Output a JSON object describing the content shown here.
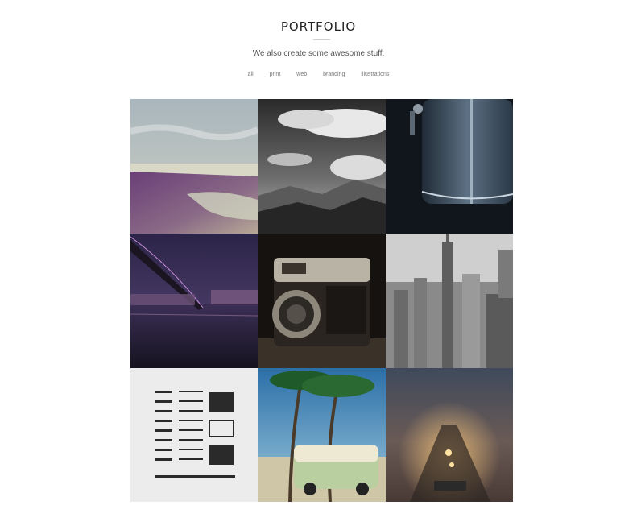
{
  "header": {
    "title": "PORTFOLIO",
    "subtitle": "We also create some awesome stuff."
  },
  "filters": [
    "all",
    "print",
    "web",
    "branding",
    "illustrations"
  ],
  "portfolio": {
    "items": [
      "beach-photo",
      "mountains-clouds-photo",
      "metal-tank-photo",
      "bridge-night-photo",
      "vintage-camera-photo",
      "city-skyline-photo",
      "typewriter-parts-photo",
      "palm-van-photo",
      "foggy-road-photo"
    ]
  },
  "colors": {
    "background": "#ffffff",
    "title": "#222222",
    "divider": "#cfcfcf"
  }
}
